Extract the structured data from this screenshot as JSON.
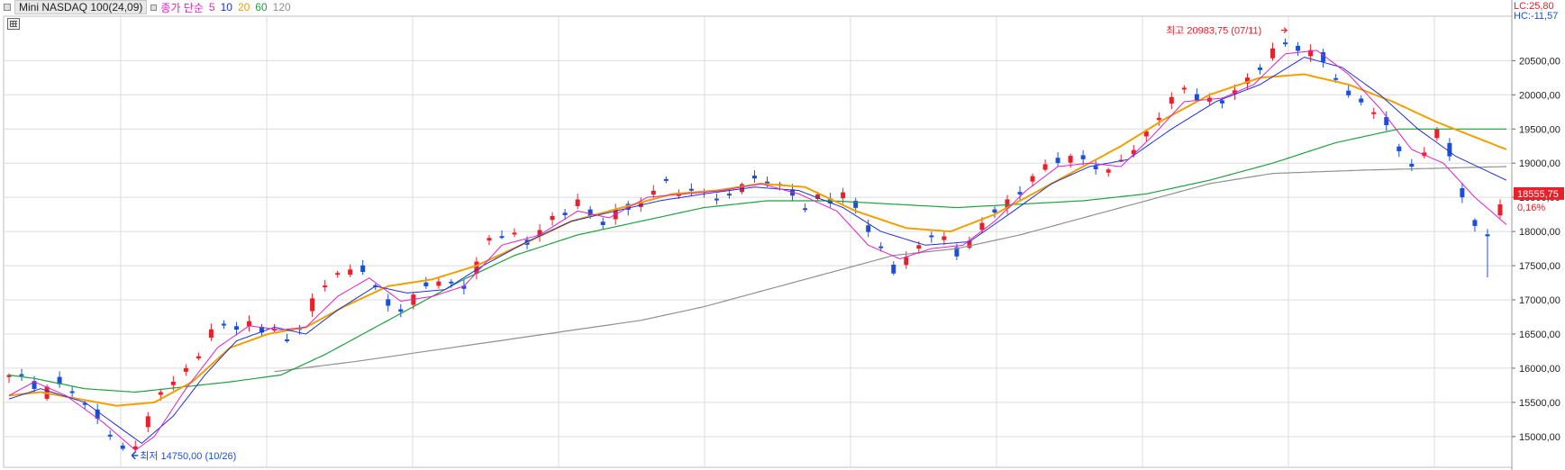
{
  "legend": {
    "title": "Mini NASDAQ 100(24,09)",
    "ma_label": "종가 단순",
    "periods": [
      "5",
      "10",
      "20",
      "60",
      "120"
    ]
  },
  "right_info": {
    "lc": "LC:25,80",
    "hc": "HC:-11,57"
  },
  "last_price": {
    "value": "18555,75",
    "change": "0,16%"
  },
  "annotations": {
    "high": "최고 20983,75 (07/11)",
    "low": "최저 14750,00 (10/26)"
  },
  "colors": {
    "up": "#e8202a",
    "down": "#1b4fd6",
    "ma5": "#e020c8",
    "ma10": "#2030d8",
    "ma20": "#f0a000",
    "ma60": "#20a040",
    "ma120": "#909090",
    "grid": "#dcdcdc",
    "axis_text": "#222222",
    "accent_red": "#e8202a",
    "accent_blue": "#1b4fd6"
  },
  "chart_data": {
    "type": "candlestick",
    "y_ticks": [
      15000,
      15500,
      16000,
      16500,
      17000,
      17500,
      18000,
      18500,
      19000,
      19500,
      20000,
      20500
    ],
    "y_tick_labels": [
      "15000,00",
      "15500,00",
      "16000,00",
      "16500,00",
      "17000,00",
      "17500,00",
      "18000,00",
      "18500,00",
      "19000,00",
      "19500,00",
      "20000,00",
      "20500,00"
    ],
    "ylim": [
      14550,
      21150
    ],
    "price_path": [
      [
        15870,
        0
      ],
      [
        15930,
        3
      ],
      [
        15760,
        7
      ],
      [
        15620,
        11
      ],
      [
        15850,
        14
      ],
      [
        15720,
        18
      ],
      [
        15520,
        23
      ],
      [
        15330,
        27
      ],
      [
        15100,
        31
      ],
      [
        14840,
        34
      ],
      [
        14750,
        38
      ],
      [
        14960,
        41
      ],
      [
        15380,
        45
      ],
      [
        15730,
        49
      ],
      [
        15880,
        53
      ],
      [
        15960,
        57
      ],
      [
        16320,
        61
      ],
      [
        16620,
        65
      ],
      [
        16630,
        69
      ],
      [
        16620,
        75
      ],
      [
        16580,
        80
      ],
      [
        16560,
        84
      ],
      [
        16390,
        88
      ],
      [
        16620,
        92
      ],
      [
        16960,
        96
      ],
      [
        17250,
        100
      ],
      [
        17380,
        103
      ],
      [
        17420,
        108
      ],
      [
        17450,
        113
      ],
      [
        17100,
        117
      ],
      [
        16860,
        121
      ],
      [
        16830,
        125
      ],
      [
        17140,
        129
      ],
      [
        17220,
        133
      ],
      [
        17310,
        137
      ],
      [
        17180,
        141
      ],
      [
        17190,
        145
      ],
      [
        17680,
        149
      ],
      [
        17940,
        153
      ],
      [
        18000,
        157
      ],
      [
        17900,
        161
      ],
      [
        17820,
        165
      ],
      [
        18100,
        169
      ],
      [
        18200,
        173
      ],
      [
        18350,
        177
      ],
      [
        18420,
        181
      ],
      [
        18200,
        185
      ],
      [
        18080,
        189
      ],
      [
        18330,
        193
      ],
      [
        18400,
        197
      ],
      [
        18380,
        201
      ],
      [
        18690,
        205
      ],
      [
        18780,
        209
      ],
      [
        18420,
        213
      ],
      [
        18700,
        217
      ],
      [
        18540,
        221
      ],
      [
        18430,
        225
      ],
      [
        18580,
        229
      ],
      [
        18720,
        233
      ],
      [
        18780,
        237
      ],
      [
        18750,
        241
      ],
      [
        18640,
        245
      ],
      [
        18500,
        249
      ],
      [
        18300,
        253
      ],
      [
        18560,
        257
      ],
      [
        18440,
        261
      ],
      [
        18560,
        265
      ],
      [
        18280,
        269
      ],
      [
        17950,
        273
      ],
      [
        17600,
        277
      ],
      [
        17410,
        281
      ],
      [
        17640,
        285
      ],
      [
        17850,
        289
      ],
      [
        18000,
        293
      ],
      [
        17820,
        297
      ],
      [
        17650,
        301
      ],
      [
        17900,
        305
      ],
      [
        18190,
        309
      ],
      [
        18350,
        313
      ],
      [
        18460,
        317
      ],
      [
        18600,
        321
      ],
      [
        18880,
        325
      ],
      [
        19000,
        329
      ],
      [
        19020,
        333
      ],
      [
        19140,
        337
      ],
      [
        19000,
        341
      ],
      [
        18920,
        345
      ],
      [
        18880,
        349
      ],
      [
        19090,
        353
      ],
      [
        19280,
        357
      ],
      [
        19450,
        361
      ],
      [
        19800,
        365
      ],
      [
        20000,
        369
      ],
      [
        20100,
        373
      ],
      [
        19950,
        377
      ],
      [
        19860,
        381
      ],
      [
        19950,
        385
      ],
      [
        20090,
        389
      ],
      [
        20260,
        393
      ],
      [
        20480,
        397
      ],
      [
        20660,
        401
      ],
      [
        20830,
        405
      ],
      [
        20580,
        409
      ],
      [
        20640,
        413
      ],
      [
        20480,
        417
      ],
      [
        20120,
        421
      ],
      [
        19960,
        425
      ],
      [
        19880,
        429
      ],
      [
        19680,
        433
      ],
      [
        19520,
        437
      ],
      [
        19080,
        441
      ],
      [
        18870,
        445
      ],
      [
        19280,
        449
      ],
      [
        19570,
        453
      ],
      [
        18900,
        457
      ],
      [
        18440,
        461
      ],
      [
        17890,
        465
      ],
      [
        17980,
        469
      ],
      [
        18555,
        473
      ]
    ],
    "ma_paths": {
      "ma5": [
        [
          15600,
          0
        ],
        [
          15800,
          8
        ],
        [
          15600,
          18
        ],
        [
          15200,
          30
        ],
        [
          14800,
          40
        ],
        [
          15000,
          46
        ],
        [
          15700,
          56
        ],
        [
          16300,
          66
        ],
        [
          16620,
          76
        ],
        [
          16560,
          86
        ],
        [
          16600,
          94
        ],
        [
          17050,
          104
        ],
        [
          17320,
          114
        ],
        [
          16980,
          124
        ],
        [
          17050,
          134
        ],
        [
          17200,
          144
        ],
        [
          17800,
          156
        ],
        [
          17950,
          168
        ],
        [
          18300,
          180
        ],
        [
          18200,
          190
        ],
        [
          18500,
          202
        ],
        [
          18550,
          214
        ],
        [
          18600,
          226
        ],
        [
          18700,
          238
        ],
        [
          18550,
          250
        ],
        [
          18300,
          262
        ],
        [
          17800,
          272
        ],
        [
          17600,
          282
        ],
        [
          17750,
          292
        ],
        [
          17800,
          302
        ],
        [
          18150,
          312
        ],
        [
          18600,
          322
        ],
        [
          18950,
          332
        ],
        [
          19000,
          342
        ],
        [
          18950,
          352
        ],
        [
          19400,
          362
        ],
        [
          19900,
          372
        ],
        [
          19950,
          384
        ],
        [
          20150,
          394
        ],
        [
          20600,
          404
        ],
        [
          20650,
          414
        ],
        [
          20300,
          424
        ],
        [
          19800,
          434
        ],
        [
          19200,
          444
        ],
        [
          19000,
          454
        ],
        [
          18500,
          464
        ],
        [
          18100,
          474
        ]
      ],
      "ma10": [
        [
          15550,
          0
        ],
        [
          15700,
          10
        ],
        [
          15500,
          24
        ],
        [
          15100,
          36
        ],
        [
          14900,
          42
        ],
        [
          15300,
          52
        ],
        [
          15900,
          62
        ],
        [
          16400,
          72
        ],
        [
          16600,
          84
        ],
        [
          16500,
          94
        ],
        [
          16850,
          104
        ],
        [
          17200,
          116
        ],
        [
          17100,
          126
        ],
        [
          17150,
          138
        ],
        [
          17500,
          150
        ],
        [
          17850,
          164
        ],
        [
          18150,
          178
        ],
        [
          18300,
          192
        ],
        [
          18450,
          206
        ],
        [
          18550,
          220
        ],
        [
          18650,
          236
        ],
        [
          18600,
          250
        ],
        [
          18350,
          264
        ],
        [
          18000,
          276
        ],
        [
          17800,
          290
        ],
        [
          17850,
          304
        ],
        [
          18300,
          318
        ],
        [
          18700,
          330
        ],
        [
          18950,
          342
        ],
        [
          19050,
          354
        ],
        [
          19500,
          368
        ],
        [
          19900,
          382
        ],
        [
          20150,
          396
        ],
        [
          20550,
          410
        ],
        [
          20400,
          422
        ],
        [
          20000,
          434
        ],
        [
          19500,
          446
        ],
        [
          19100,
          458
        ],
        [
          18750,
          474
        ]
      ],
      "ma20": [
        [
          15600,
          0
        ],
        [
          15650,
          10
        ],
        [
          15550,
          22
        ],
        [
          15450,
          34
        ],
        [
          15500,
          46
        ],
        [
          15800,
          58
        ],
        [
          16300,
          70
        ],
        [
          16500,
          82
        ],
        [
          16600,
          94
        ],
        [
          16900,
          106
        ],
        [
          17200,
          120
        ],
        [
          17300,
          134
        ],
        [
          17500,
          148
        ],
        [
          17800,
          162
        ],
        [
          18150,
          178
        ],
        [
          18350,
          194
        ],
        [
          18550,
          210
        ],
        [
          18600,
          224
        ],
        [
          18700,
          238
        ],
        [
          18650,
          252
        ],
        [
          18300,
          268
        ],
        [
          18050,
          284
        ],
        [
          18000,
          298
        ],
        [
          18250,
          312
        ],
        [
          18600,
          326
        ],
        [
          18900,
          338
        ],
        [
          19250,
          352
        ],
        [
          19650,
          366
        ],
        [
          20000,
          380
        ],
        [
          20250,
          396
        ],
        [
          20300,
          410
        ],
        [
          20150,
          424
        ],
        [
          19900,
          438
        ],
        [
          19600,
          452
        ],
        [
          19200,
          474
        ]
      ],
      "ma60": [
        [
          15900,
          0
        ],
        [
          15850,
          8
        ],
        [
          15700,
          24
        ],
        [
          15650,
          40
        ],
        [
          15720,
          54
        ],
        [
          15800,
          70
        ],
        [
          15900,
          86
        ],
        [
          16200,
          100
        ],
        [
          16550,
          114
        ],
        [
          16900,
          128
        ],
        [
          17300,
          144
        ],
        [
          17650,
          160
        ],
        [
          17950,
          180
        ],
        [
          18150,
          200
        ],
        [
          18350,
          220
        ],
        [
          18450,
          240
        ],
        [
          18450,
          260
        ],
        [
          18400,
          280
        ],
        [
          18350,
          300
        ],
        [
          18400,
          320
        ],
        [
          18450,
          340
        ],
        [
          18550,
          360
        ],
        [
          18750,
          380
        ],
        [
          19000,
          400
        ],
        [
          19300,
          420
        ],
        [
          19500,
          440
        ],
        [
          19500,
          474
        ]
      ],
      "ma120": [
        [
          15950,
          84
        ],
        [
          16100,
          110
        ],
        [
          16300,
          140
        ],
        [
          16500,
          170
        ],
        [
          16700,
          200
        ],
        [
          16900,
          220
        ],
        [
          17150,
          240
        ],
        [
          17400,
          260
        ],
        [
          17650,
          280
        ],
        [
          17750,
          300
        ],
        [
          17950,
          320
        ],
        [
          18200,
          340
        ],
        [
          18450,
          360
        ],
        [
          18700,
          380
        ],
        [
          18850,
          400
        ],
        [
          18900,
          430
        ],
        [
          18950,
          474
        ]
      ]
    },
    "highlight_points": {
      "high": {
        "value": 20983.75,
        "date": "07/11"
      },
      "low": {
        "value": 14750.0,
        "date": "10/26"
      }
    }
  }
}
